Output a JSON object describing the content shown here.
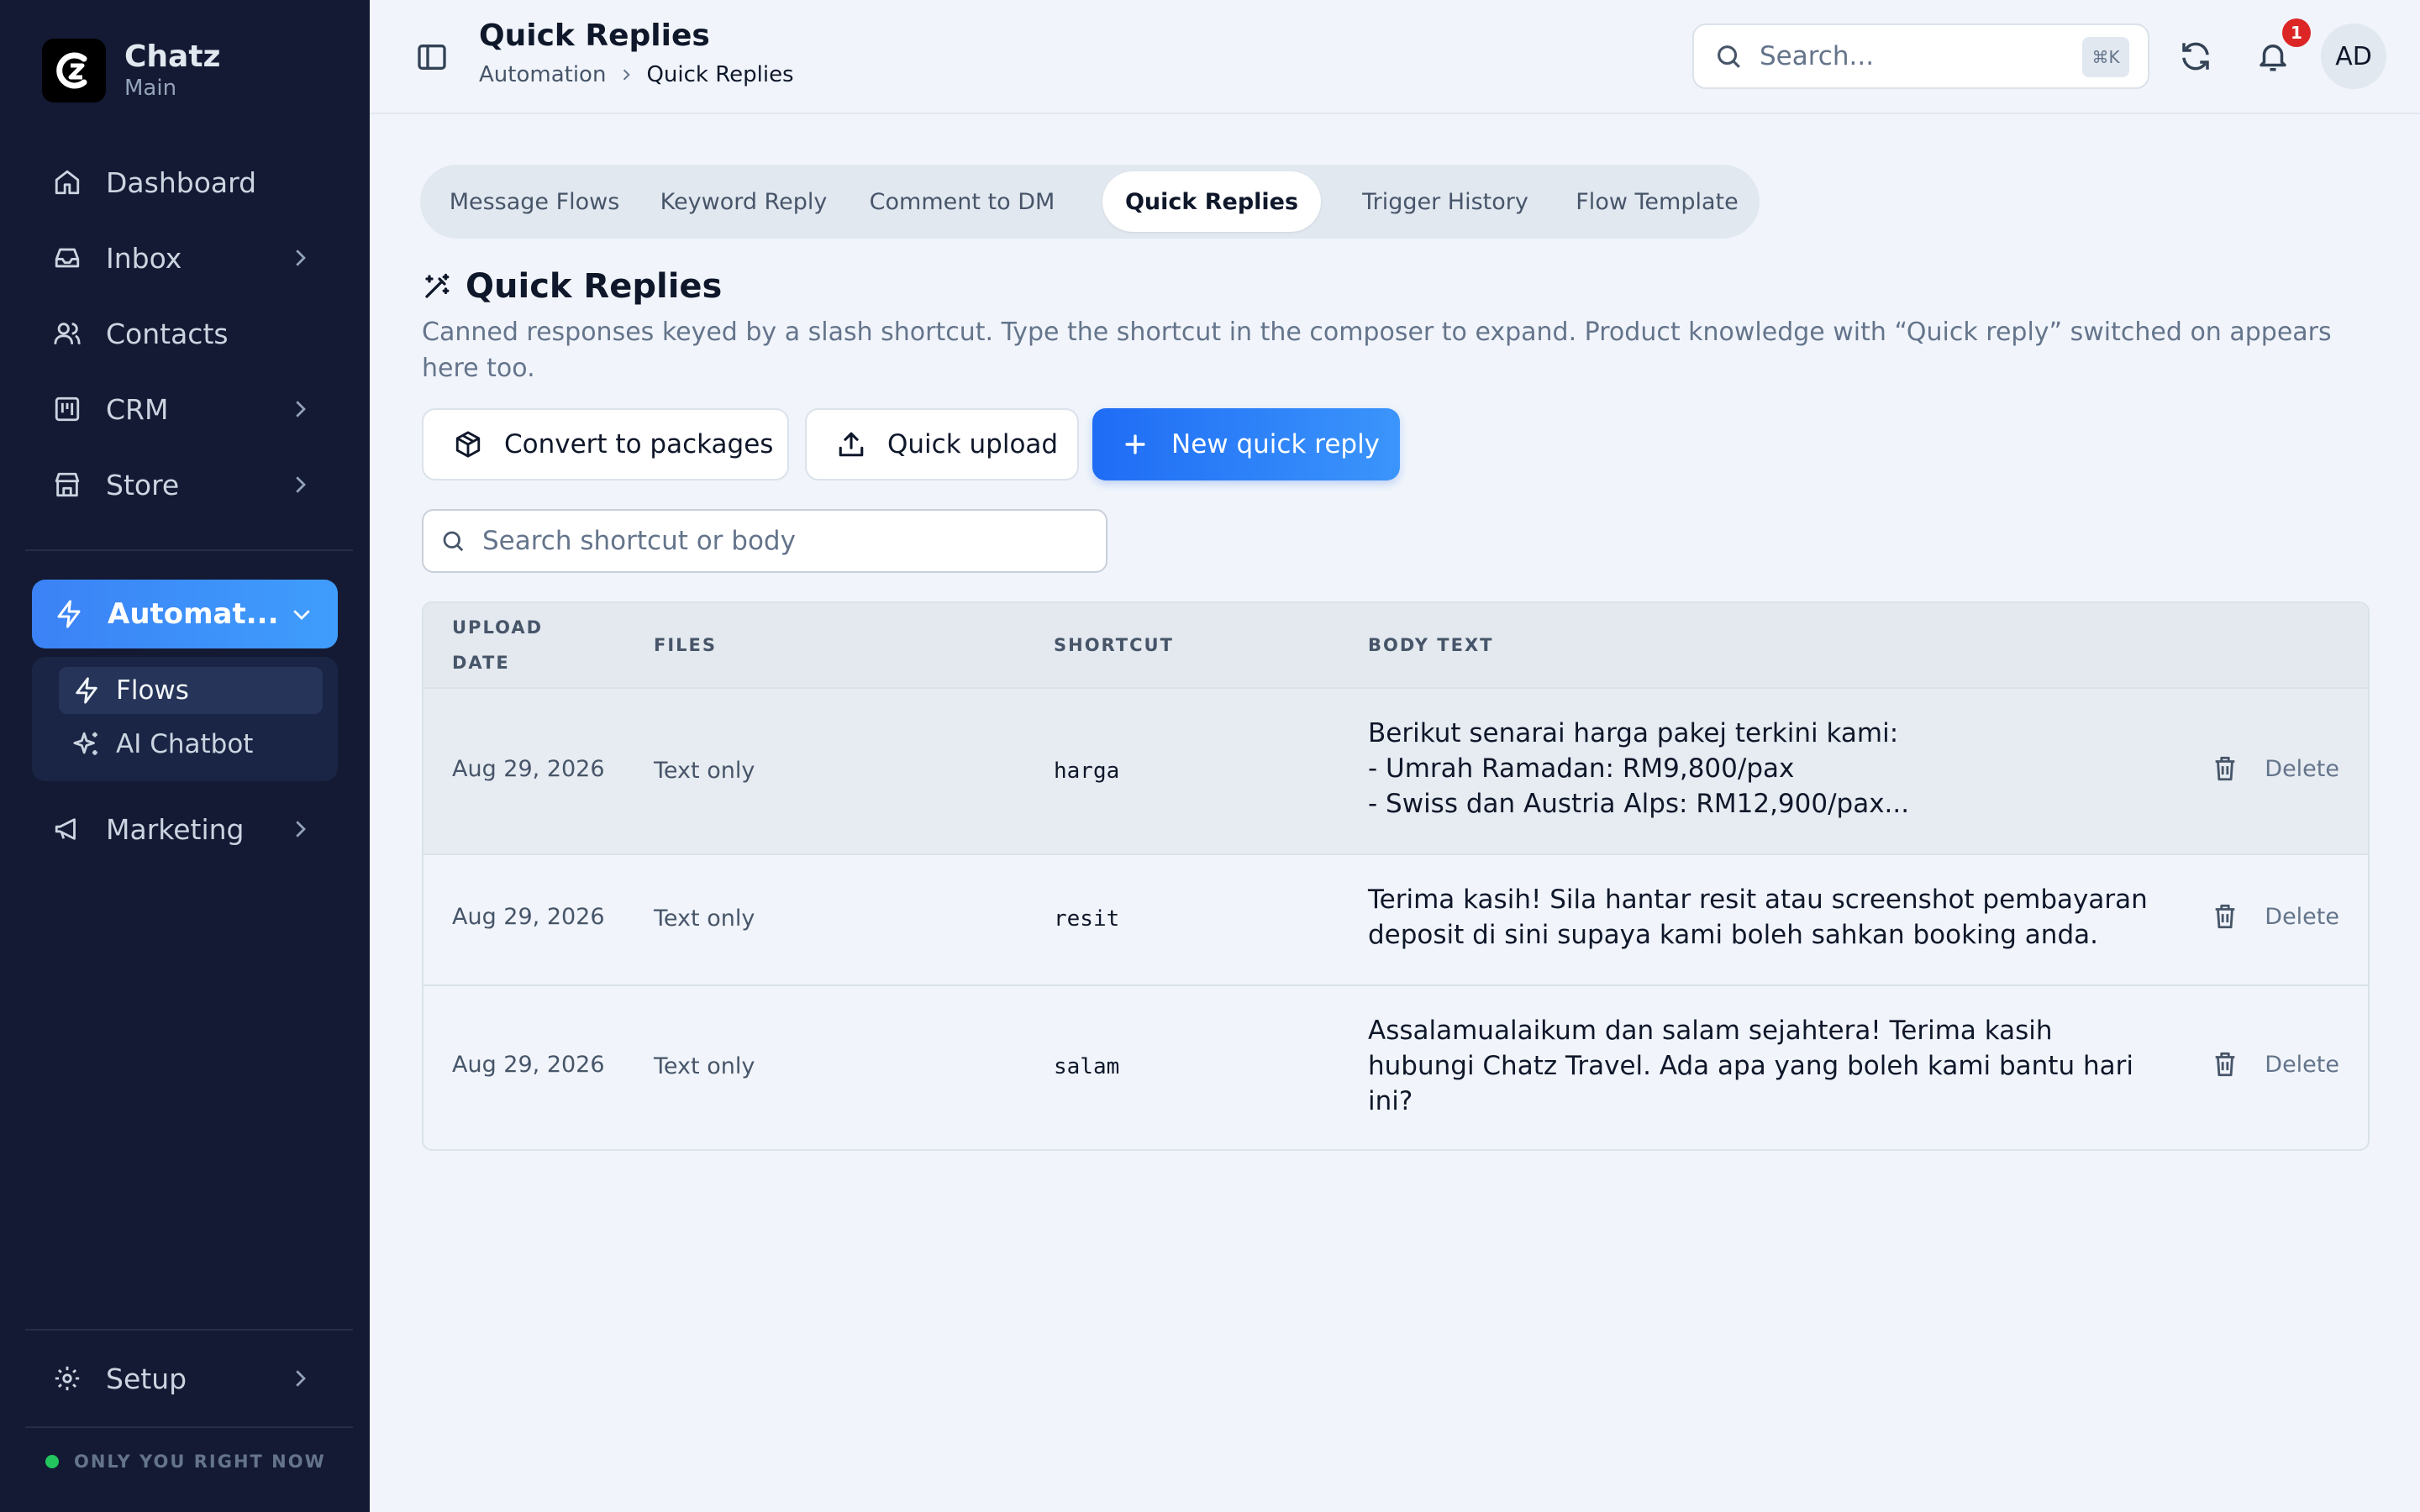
{
  "brand": {
    "name": "Chatz",
    "workspace": "Main"
  },
  "sidebar": {
    "items": [
      {
        "label": "Dashboard",
        "icon": "home-icon"
      },
      {
        "label": "Inbox",
        "icon": "inbox-icon"
      },
      {
        "label": "Contacts",
        "icon": "users-icon"
      },
      {
        "label": "CRM",
        "icon": "kanban-icon"
      },
      {
        "label": "Store",
        "icon": "store-icon"
      }
    ],
    "active": {
      "label": "Automat...",
      "icon": "zap-icon"
    },
    "subitems": [
      {
        "label": "Flows",
        "icon": "zap-icon"
      },
      {
        "label": "AI Chatbot",
        "icon": "sparkles-icon"
      }
    ],
    "marketing": "Marketing",
    "setup": "Setup",
    "status": "ONLY YOU RIGHT NOW"
  },
  "header": {
    "title": "Quick Replies",
    "breadcrumb": [
      "Automation",
      "Quick Replies"
    ],
    "search_placeholder": "Search...",
    "shortcut": "⌘K",
    "notification_count": "1",
    "avatar": "AD"
  },
  "tabs": [
    {
      "label": "Message Flows"
    },
    {
      "label": "Keyword Reply"
    },
    {
      "label": "Comment to DM"
    },
    {
      "label": "Quick Replies"
    },
    {
      "label": "Trigger History"
    },
    {
      "label": "Flow Template"
    }
  ],
  "section": {
    "title": "Quick Replies",
    "description": "Canned responses keyed by a slash shortcut. Type the shortcut in the composer to expand. Product knowledge with “Quick reply” switched on appears here too."
  },
  "actions": {
    "convert": "Convert to packages",
    "upload": "Quick upload",
    "new": "New quick reply"
  },
  "search_body_placeholder": "Search shortcut or body",
  "table": {
    "headers": {
      "upload_date_1": "UPLOAD",
      "upload_date_2": "DATE",
      "files": "FILES",
      "shortcut": "SHORTCUT",
      "body": "BODY TEXT"
    },
    "rows": [
      {
        "date": "Aug 29, 2026",
        "files": "Text only",
        "shortcut": "harga",
        "body": "Berikut senarai harga pakej terkini kami:\n- Umrah Ramadan: RM9,800/pax\n- Swiss dan Austria Alps: RM12,900/pax...",
        "action": "Delete"
      },
      {
        "date": "Aug 29, 2026",
        "files": "Text only",
        "shortcut": "resit",
        "body": "Terima kasih! Sila hantar resit atau screenshot pembayaran\ndeposit di sini supaya kami boleh sahkan booking anda.",
        "action": "Delete"
      },
      {
        "date": "Aug 29, 2026",
        "files": "Text only",
        "shortcut": "salam",
        "body": "Assalamualaikum dan salam sejahtera! Terima kasih\nhubungi Chatz Travel. Ada apa yang boleh kami bantu hari\nini?",
        "action": "Delete"
      }
    ]
  },
  "colors": {
    "sidebar_bg": "#141a33",
    "accent": "#3b82f6",
    "primary_button": "#1f6cf5",
    "badge": "#dc2626",
    "status_online": "#22c55e"
  }
}
